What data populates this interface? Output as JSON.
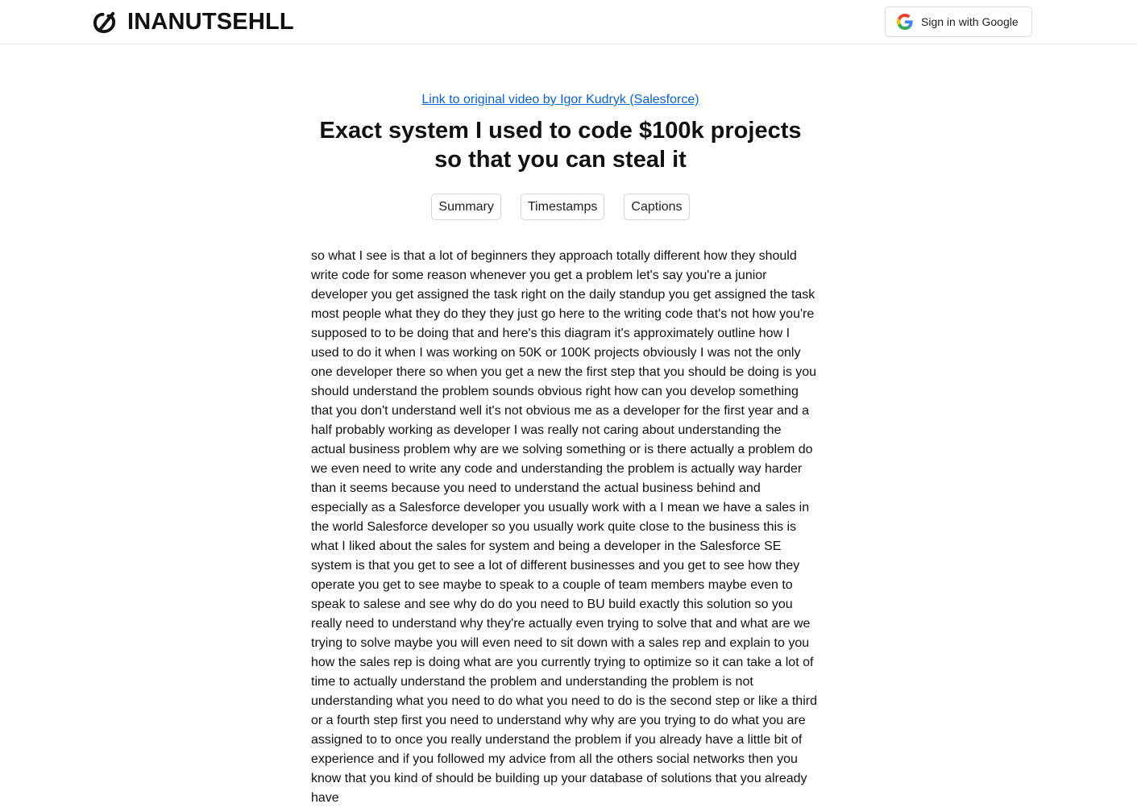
{
  "header": {
    "brand_name": "INANUTSEHLL",
    "signin_label": "Sign in with Google"
  },
  "video": {
    "link_text": "Link to original video by Igor Kudryk (Salesforce)",
    "title": "Exact system I used to code $100k projects so that you can steal it"
  },
  "tabs": [
    {
      "label": "Summary"
    },
    {
      "label": "Timestamps"
    },
    {
      "label": "Captions"
    }
  ],
  "transcript": {
    "text": "so what I see is that a lot of beginners they approach totally different how they should write code for some reason whenever you get a problem let's say you're a junior developer you get assigned the task right on the daily standup you get assigned the task most people what they do they they just go here to the writing code that's not how you're supposed to to be doing that and here's this diagram it's approximately outline how I used to do it when I was working on 50K or 100K projects obviously I was not the only one developer there so when you get a new the first step that you should be doing is you should understand the problem sounds obvious right how can you develop something that you don't understand well it's not obvious me as a developer for the first year and a half probably working as developer I was really not caring about understanding the actual business problem why are we solving something or is there actually a problem do we even need to write any code and understanding the problem is actually way harder than it seems because you need to understand the actual business behind and especially as a Salesforce developer you usually work with a I mean we have a sales in the world Salesforce developer so you usually work quite close to the business this is what I liked about the sales for system and being a developer in the Salesforce SE system is that you get to see a lot of different businesses and you get to see how they operate you get to see maybe to speak to a couple of team members maybe even to speak to salese and see why do do you need to BU build exactly this solution so you really need to understand why they're actually even trying to solve that and what are we trying to solve maybe you will even need to sit down with a sales rep and explain to you how the sales rep is doing what are you currently trying to optimize so it can take a lot of time to actually understand the problem and understanding the problem is not understanding what you need to do what you need to do is the second step or like a third or a fourth step first you need to understand why why are you trying to do what you are assigned to to once you really understand the problem if you already have a little bit of experience and if you followed my advice from all the others social networks then you know that you kind of should be building up your database of solutions that you already have"
  },
  "colors": {
    "link": "#0b63d1",
    "text": "#111111",
    "border": "#d4d4d4"
  }
}
